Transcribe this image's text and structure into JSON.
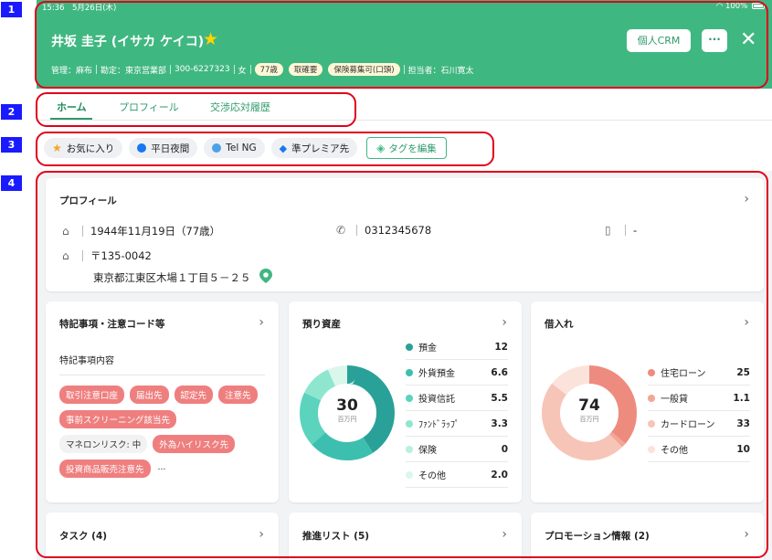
{
  "markers": [
    "1",
    "2",
    "3",
    "4"
  ],
  "status": {
    "time_date": "15:36　5月26日(木)",
    "battery": "100%"
  },
  "header": {
    "customer_name": "井坂 圭子 (イサカ ケイコ)",
    "crm_button": "個人CRM",
    "more_button": "···",
    "close_button": "✕",
    "meta_items": [
      "管理：麻布",
      "勘定：東京営業部",
      "300-6227323",
      "女"
    ],
    "pills": [
      "77歳",
      "取確要",
      "保険募集可(口頭)"
    ],
    "agent": "担当者：石川寛太",
    "accent_color": "#3fb781"
  },
  "tabs": [
    {
      "label": "ホーム",
      "active": true
    },
    {
      "label": "プロフィール"
    },
    {
      "label": "交渉応対履歴"
    }
  ],
  "tags": [
    {
      "label": "お気に入り",
      "icon": "star",
      "color": "#f5a623"
    },
    {
      "label": "平日夜間",
      "icon": "dot",
      "color": "#1877f2"
    },
    {
      "label": "Tel NG",
      "icon": "dot",
      "color": "#4aa3e8"
    },
    {
      "label": "準プレミア先",
      "icon": "diamond",
      "color": "#1877f2"
    }
  ],
  "edit_tags_label": "タグを編集",
  "profile": {
    "title": "プロフィール",
    "birthday": "1944年11月19日（77歳）",
    "phone": "0312345678",
    "mobile": "-",
    "postal": "〒135-0042",
    "address": "東京都江東区木場１丁目５－２５"
  },
  "notes": {
    "title": "特記事項・注意コード等",
    "label": "特記事項内容",
    "chips": [
      {
        "label": "取引注意口座",
        "style": "red"
      },
      {
        "label": "届出先",
        "style": "red"
      },
      {
        "label": "認定先",
        "style": "red"
      },
      {
        "label": "注意先",
        "style": "red"
      },
      {
        "label": "事前スクリーニング該当先",
        "style": "red"
      },
      {
        "label": "マネロンリスク: 中",
        "style": "grey"
      },
      {
        "label": "外為ハイリスク先",
        "style": "red"
      },
      {
        "label": "投資商品販売注意先",
        "style": "red"
      },
      {
        "label": "...",
        "style": "more"
      }
    ]
  },
  "assets": {
    "title": "預り資産",
    "total": "30",
    "unit": "百万円",
    "items": [
      {
        "label": "預金",
        "value": 12,
        "color": "#2aa198"
      },
      {
        "label": "外貨預金",
        "value": 6.6,
        "color": "#3cbfae"
      },
      {
        "label": "投資信託",
        "value": 5.5,
        "color": "#5bd3bd"
      },
      {
        "label": "ﾌｧﾝﾄﾞﾗｯﾌﾟ",
        "value": 3.3,
        "color": "#8ee6cf"
      },
      {
        "label": "保険",
        "value": 0,
        "color": "#b7f0dc"
      },
      {
        "label": "その他",
        "value": 2.0,
        "color": "#d9f7ea"
      }
    ]
  },
  "loans": {
    "title": "借入れ",
    "total": "74",
    "unit": "百万円",
    "items": [
      {
        "label": "住宅ローン",
        "value": 25,
        "color": "#ee8b7f"
      },
      {
        "label": "一般貸",
        "value": 1.1,
        "color": "#f3a596"
      },
      {
        "label": "カードローン",
        "value": 33,
        "color": "#f7c4b8"
      },
      {
        "label": "その他",
        "value": 10,
        "color": "#fbe3db"
      }
    ]
  },
  "bottom_cards": [
    {
      "title": "タスク (4)"
    },
    {
      "title": "推進リスト (5)"
    },
    {
      "title": "プロモーション情報 (2)"
    }
  ]
}
